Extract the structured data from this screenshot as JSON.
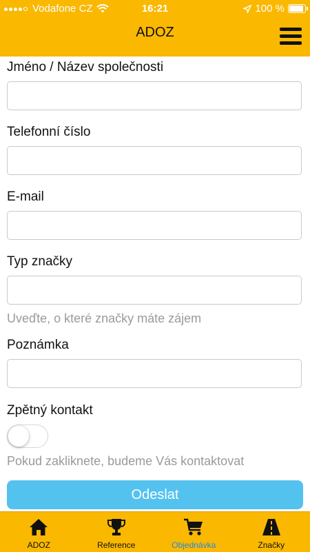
{
  "status": {
    "carrier": "Vodafone CZ",
    "time": "16:21",
    "battery": "100 %"
  },
  "header": {
    "title": "ADOZ"
  },
  "form": {
    "name_label": "Jméno / Název společnosti",
    "name_value": "",
    "phone_label": "Telefonní číslo",
    "phone_value": "",
    "email_label": "E-mail",
    "email_value": "",
    "type_label": "Typ značky",
    "type_value": "",
    "type_hint": "Uveďte, o které značky máte zájem",
    "note_label": "Poznámka",
    "note_value": "",
    "contact_label": "Zpětný kontakt",
    "contact_on": false,
    "contact_hint": "Pokud zakliknete, budeme Vás kontaktovat",
    "submit_label": "Odeslat"
  },
  "tabs": [
    {
      "label": "ADOZ",
      "icon": "home-icon",
      "active": false
    },
    {
      "label": "Reference",
      "icon": "trophy-icon",
      "active": false
    },
    {
      "label": "Objednávka",
      "icon": "cart-icon",
      "active": true
    },
    {
      "label": "Značky",
      "icon": "road-icon",
      "active": false
    }
  ],
  "colors": {
    "accent": "#fab800",
    "button": "#54c2ef",
    "active_tab": "#1e88e5"
  }
}
